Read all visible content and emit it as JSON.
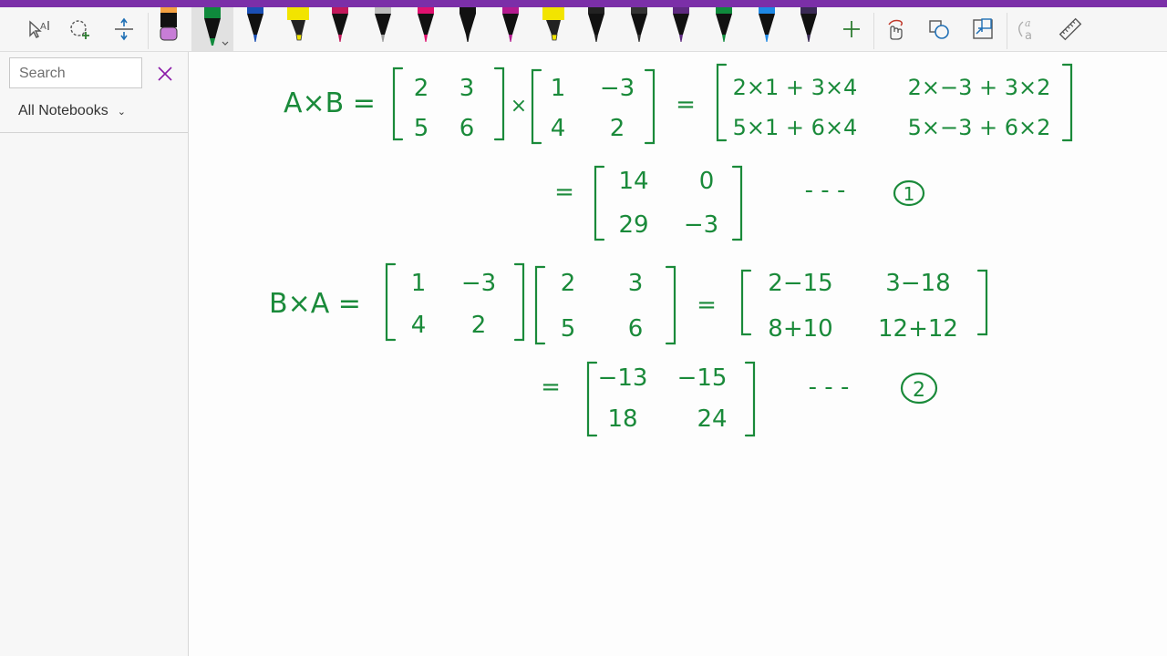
{
  "toolbar": {
    "tools": [
      {
        "icon": "lasso-select-icon"
      },
      {
        "icon": "add-space-icon"
      },
      {
        "icon": "insert-space-icon"
      }
    ],
    "pens": [
      {
        "icon": "highlighter-pen-icon",
        "color": "#c77dd6",
        "tip": "#f4a142"
      },
      {
        "icon": "pen-icon",
        "color": "#0f8a3c",
        "selected": true
      },
      {
        "icon": "pen-icon",
        "color": "#1a4fb5"
      },
      {
        "icon": "highlighter-pen-icon",
        "color": "#f2e400"
      },
      {
        "icon": "pen-icon",
        "color": "#c2185b"
      },
      {
        "icon": "galaxy-pen-icon",
        "color": "#9e9e9e"
      },
      {
        "icon": "pen-icon",
        "color": "#e0116f"
      },
      {
        "icon": "pen-icon",
        "color": "#111111"
      },
      {
        "icon": "pen-icon",
        "color": "#b31b8f"
      },
      {
        "icon": "highlighter-pen-icon",
        "color": "#f2e400"
      },
      {
        "icon": "pen-icon",
        "color": "#222222"
      },
      {
        "icon": "pen-icon",
        "color": "#333333"
      },
      {
        "icon": "pen-icon",
        "color": "#5e2a80"
      },
      {
        "icon": "pen-icon",
        "color": "#0f8a3c"
      },
      {
        "icon": "pen-icon",
        "color": "#1e88e5"
      },
      {
        "icon": "pen-icon",
        "color": "#3a2a55"
      }
    ],
    "actions": [
      {
        "icon": "add-pen-icon"
      },
      {
        "icon": "touch-drawing-icon"
      },
      {
        "icon": "ink-to-shape-icon"
      },
      {
        "icon": "ink-to-text-icon"
      },
      {
        "icon": "ink-to-math-icon"
      },
      {
        "icon": "ruler-icon"
      }
    ]
  },
  "sidebar": {
    "search_placeholder": "Search",
    "notebooks_label": "All Notebooks"
  },
  "ink": {
    "color": "#1a8a3a",
    "eq1_lhs": "A×B =",
    "matA": {
      "r1": [
        "2",
        "3"
      ],
      "r2": [
        "5",
        "6"
      ]
    },
    "times": "×",
    "matB": {
      "r1": [
        "1",
        "−3"
      ],
      "r2": [
        "4",
        "2"
      ]
    },
    "eq1_eq": "=",
    "prod1": {
      "r1": [
        "2×1 + 3×4",
        "2×−3 + 3×2"
      ],
      "r2": [
        "5×1 + 6×4",
        "5×−3 + 6×2"
      ]
    },
    "eq2_eq": "=",
    "res1": {
      "r1": [
        "14",
        "0"
      ],
      "r2": [
        "29",
        "−3"
      ]
    },
    "dashes1": "- - -",
    "tag1": "1",
    "eq3_lhs": "B×A =",
    "matB2": {
      "r1": [
        "1",
        "−3"
      ],
      "r2": [
        "4",
        "2"
      ]
    },
    "matA2": {
      "r1": [
        "2",
        "3"
      ],
      "r2": [
        "5",
        "6"
      ]
    },
    "eq3_eq": "=",
    "prod2": {
      "r1": [
        "2−15",
        "3−18"
      ],
      "r2": [
        "8+10",
        "12+12"
      ]
    },
    "eq4_eq": "=",
    "res2": {
      "r1": [
        "−13",
        "−15"
      ],
      "r2": [
        "18",
        "24"
      ]
    },
    "dashes2": "- - -",
    "tag2": "2"
  }
}
